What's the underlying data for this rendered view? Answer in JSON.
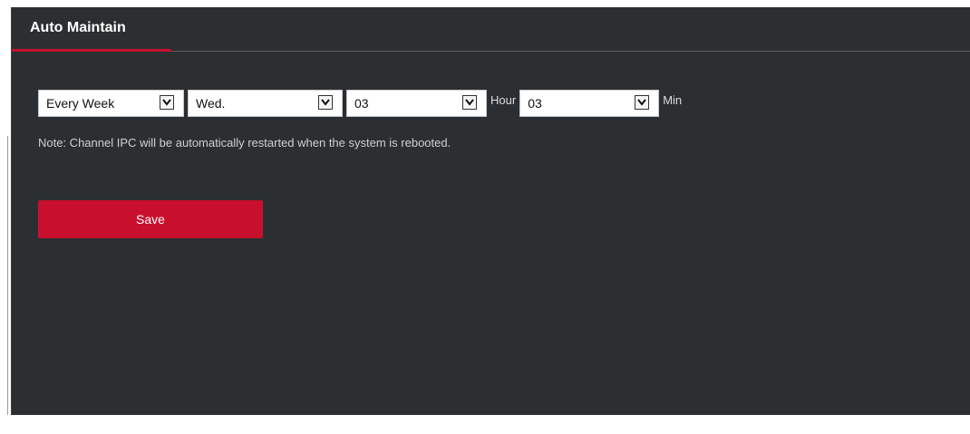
{
  "tab": {
    "label": "Auto Maintain"
  },
  "schedule": {
    "frequency": "Every Week",
    "day": "Wed.",
    "hour": "03",
    "hour_unit": "Hour",
    "minute": "03",
    "minute_unit": "Min"
  },
  "note": "Note: Channel IPC will be automatically restarted when the system is rebooted.",
  "actions": {
    "save_label": "Save"
  },
  "colors": {
    "panel_bg": "#2c2f31",
    "accent": "#c8102e"
  },
  "icons": {
    "dropdown": "chevron-down-icon"
  }
}
